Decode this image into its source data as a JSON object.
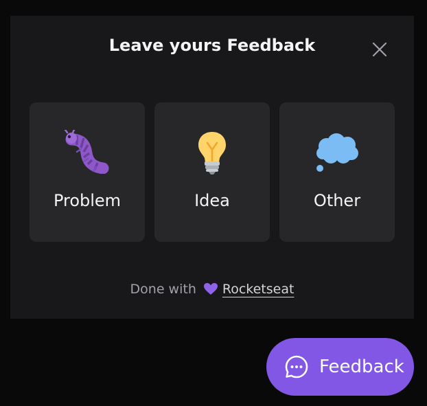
{
  "widget": {
    "title": "Leave yours Feedback",
    "close_icon": "close-icon",
    "types": [
      {
        "label": "Problem",
        "icon": "bug-icon"
      },
      {
        "label": "Idea",
        "icon": "lightbulb-icon"
      },
      {
        "label": "Other",
        "icon": "thought-balloon-icon"
      }
    ],
    "footer": {
      "prefix": "Done with",
      "heart_icon": "purple-heart-icon",
      "link_text": "Rocketseat"
    }
  },
  "feedback_button": {
    "label": "Feedback",
    "icon": "chat-bubble-icon"
  },
  "colors": {
    "accent": "#8257e5",
    "panel": "#18181b",
    "card": "#27272a",
    "background": "#09090a"
  }
}
